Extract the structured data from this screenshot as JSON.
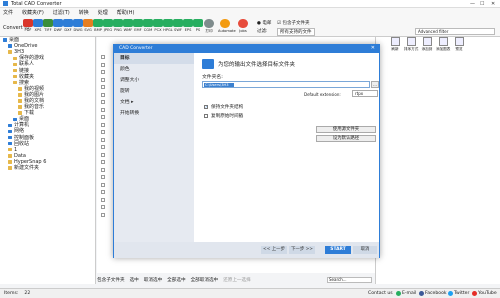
{
  "window": {
    "title": "Total CAD Converter",
    "minimize": "—",
    "maximize": "☐",
    "close": "✕"
  },
  "menu": [
    "文件",
    "收藏夹(F)",
    "过滤(T)",
    "转换",
    "处理",
    "帮助(H)"
  ],
  "toolbar": {
    "convert_to": "Convert to:",
    "formats": [
      {
        "label": "PDF",
        "color": "#d9362b"
      },
      {
        "label": "XPS",
        "color": "#2e7dd7"
      },
      {
        "label": "TIFF",
        "color": "#3b8e3b"
      },
      {
        "label": "DWF",
        "color": "#2e7dd7"
      },
      {
        "label": "DXF",
        "color": "#2e7dd7"
      },
      {
        "label": "DWG",
        "color": "#2e7dd7"
      },
      {
        "label": "SVG",
        "color": "#e67e22"
      },
      {
        "label": "BMP",
        "color": "#27ae60"
      },
      {
        "label": "JPEG",
        "color": "#27ae60"
      },
      {
        "label": "PNG",
        "color": "#27ae60"
      },
      {
        "label": "WMF",
        "color": "#27ae60"
      },
      {
        "label": "EMF",
        "color": "#27ae60"
      },
      {
        "label": "CGM",
        "color": "#27ae60"
      },
      {
        "label": "PCX",
        "color": "#27ae60"
      },
      {
        "label": "HPGL",
        "color": "#27ae60"
      },
      {
        "label": "SWF",
        "color": "#27ae60"
      },
      {
        "label": "EPS",
        "color": "#27ae60"
      },
      {
        "label": "PS",
        "color": "#27ae60"
      }
    ],
    "print_label": "打印",
    "automate_label": "Automate",
    "jobs_label": "Jobs",
    "email_label": "电邮",
    "include_subfolders": "包含子文件夹",
    "filter_label": "过滤:",
    "filter_value": "所有支持的文件",
    "advanced_filter": "Advanced filter"
  },
  "tree": [
    {
      "label": "桌面",
      "indent": 0,
      "color": "#2e7dd7"
    },
    {
      "label": "OneDrive",
      "indent": 1,
      "color": "#2e7dd7"
    },
    {
      "label": "3H3",
      "indent": 1,
      "color": "#e6b84a"
    },
    {
      "label": "保存的游戏",
      "indent": 2,
      "color": "#e6b84a"
    },
    {
      "label": "联系人",
      "indent": 2,
      "color": "#e6b84a"
    },
    {
      "label": "链接",
      "indent": 2,
      "color": "#e6b84a"
    },
    {
      "label": "收藏夹",
      "indent": 2,
      "color": "#e6b84a"
    },
    {
      "label": "搜索",
      "indent": 2,
      "color": "#e6b84a"
    },
    {
      "label": "我的视频",
      "indent": 3,
      "color": "#e6b84a"
    },
    {
      "label": "我的图片",
      "indent": 3,
      "color": "#e6b84a"
    },
    {
      "label": "我的文档",
      "indent": 3,
      "color": "#e6b84a"
    },
    {
      "label": "我的音乐",
      "indent": 3,
      "color": "#e6b84a"
    },
    {
      "label": "下载",
      "indent": 3,
      "color": "#e6b84a"
    },
    {
      "label": "桌面",
      "indent": 2,
      "color": "#2e7dd7"
    },
    {
      "label": "计算机",
      "indent": 1,
      "color": "#2e7dd7"
    },
    {
      "label": "网络",
      "indent": 1,
      "color": "#2e7dd7"
    },
    {
      "label": "控制面板",
      "indent": 1,
      "color": "#2e7dd7"
    },
    {
      "label": "回收站",
      "indent": 1,
      "color": "#2e7dd7"
    },
    {
      "label": "1",
      "indent": 1,
      "color": "#e6b84a"
    },
    {
      "label": "Data",
      "indent": 1,
      "color": "#e6b84a"
    },
    {
      "label": "HyperSnap 6",
      "indent": 1,
      "color": "#e6b84a"
    },
    {
      "label": "新建文件夹",
      "indent": 1,
      "color": "#e6b84a"
    }
  ],
  "preview": {
    "buttons": [
      "刷新",
      "排序方式",
      "添加到",
      "添加图表",
      "预览"
    ]
  },
  "bottom_bar": {
    "include_subfolders": "包含子文件夹",
    "select": "选中",
    "deselect": "取消选中",
    "select_all": "全部选中",
    "deselect_all": "全部取消选中",
    "goto_parent": "还原上一选择",
    "search_placeholder": "Search..."
  },
  "dialog": {
    "title": "CAD Converter",
    "close": "✕",
    "nav": [
      {
        "label": "目标",
        "selected": true
      },
      {
        "label": "颜色",
        "selected": false
      },
      {
        "label": "调整大小",
        "selected": false
      },
      {
        "label": "旋转",
        "selected": false
      },
      {
        "label": "文档 ▸",
        "selected": false
      },
      {
        "label": "开始转换",
        "selected": false
      }
    ],
    "heading": "为您的输出文件选择目标文件夹",
    "folder_label": "文件夹名:",
    "folder_value": "C:\\Users\\3H3",
    "browse": "...",
    "default_ext_label": "Default extension:",
    "default_ext_value": "rtpx",
    "keep_structure": "保持文件夹结构",
    "keep_structure_checked": true,
    "overwrite": "复制原始时间戳",
    "overwrite_checked": false,
    "use_source_folder": "使用源文件夹",
    "set_default_path": "设为默认路径",
    "back": "<< 上一步",
    "next": "下一步 >>",
    "start": "START",
    "cancel": "取消"
  },
  "status": {
    "items_label": "Items:",
    "items_count": "22",
    "contact_us": "Contact us",
    "email": "E-mail",
    "facebook": "Facebook",
    "twitter": "Twitter",
    "youtube": "YouTube"
  }
}
